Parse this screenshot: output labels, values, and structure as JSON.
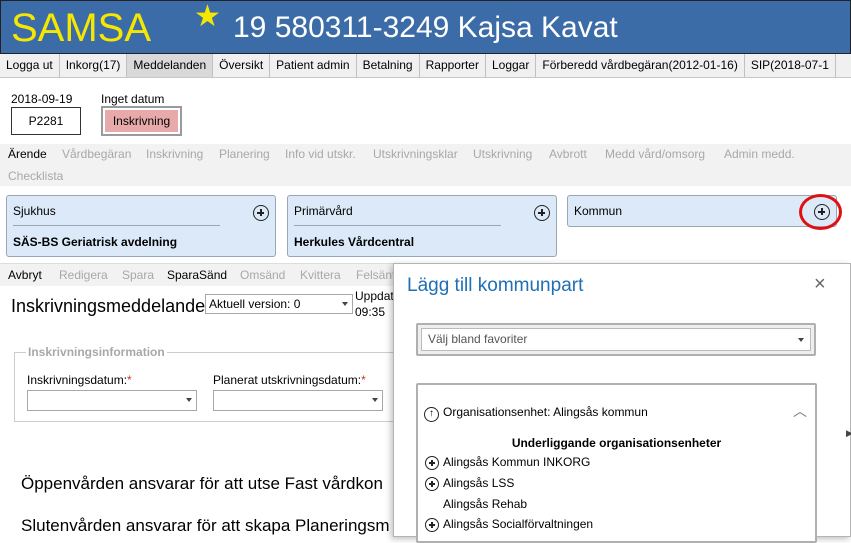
{
  "header": {
    "logo": "SAMSA",
    "patient": "19 580311-3249 Kajsa Kavat"
  },
  "menu": {
    "items": [
      "Logga ut",
      "Inkorg(17)",
      "Meddelanden",
      "Översikt",
      "Patient admin",
      "Betalning",
      "Rapporter",
      "Loggar",
      "Förberedd vårdbegäran(2012-01-16)",
      "SIP(2018-07-1"
    ],
    "active": "Meddelanden"
  },
  "info": {
    "date": "2018-09-19",
    "code": "P2281",
    "no_date": "Inget datum",
    "status": "Inskrivning"
  },
  "tabs": [
    "Ärende",
    "Vårdbegäran",
    "Inskrivning",
    "Planering",
    "Info vid utskr.",
    "Utskrivningsklar",
    "Utskrivning",
    "Avbrott",
    "Medd vård/omsorg",
    "Admin medd.",
    "Checklista"
  ],
  "parties": [
    {
      "title": "Sjukhus",
      "unit": "SÄS-BS Geriatrisk avdelning"
    },
    {
      "title": "Primärvård",
      "unit": "Herkules Vårdcentral"
    },
    {
      "title": "Kommun",
      "unit": ""
    }
  ],
  "toolbar": [
    "Avbryt",
    "Redigera",
    "Spara",
    "SparaSänd",
    "Omsänd",
    "Kvittera",
    "Felsänt"
  ],
  "form": {
    "title": "Inskrivningsmeddelande",
    "version": "Aktuell version: 0",
    "updated_label": "Uppdat",
    "updated_time": "09:35",
    "section": "Inskrivningsinformation",
    "field1": "Inskrivningsdatum:",
    "field2": "Planerat utskrivningsdatum:",
    "required": "*",
    "text1": "Öppenvården ansvarar för att utse Fast vårdkon",
    "text2": "Slutenvården ansvarar för att skapa Planeringsm"
  },
  "dialog": {
    "title": "Lägg till kommunpart",
    "close": "×",
    "favorites_placeholder": "Välj bland favoriter",
    "org_unit": "Organisationsenhet: Alingsås kommun",
    "sub_heading": "Underliggande organisationsenheter",
    "sub_units": [
      "Alingsås Kommun INKORG",
      "Alingsås LSS",
      "Alingsås Rehab",
      "Alingsås Socialförvaltningen"
    ]
  }
}
